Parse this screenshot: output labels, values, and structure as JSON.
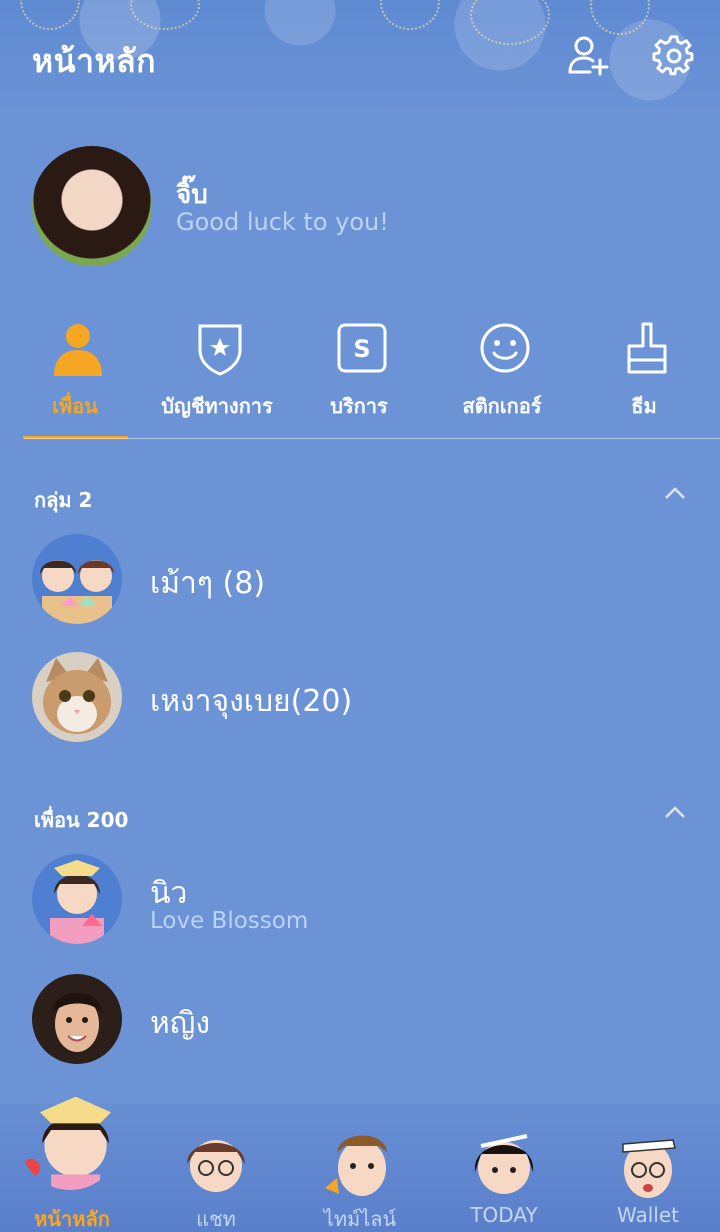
{
  "header": {
    "title": "หน้าหลัก",
    "add_friend_icon": "add-friend-icon",
    "settings_icon": "gear-icon"
  },
  "profile": {
    "name": "จิ๊บ",
    "status": "Good luck to you!"
  },
  "menu": {
    "items": [
      {
        "label": "เพื่อน",
        "icon": "person-icon",
        "active": true
      },
      {
        "label": "บัญชีทางการ",
        "icon": "shield-star-icon",
        "active": false
      },
      {
        "label": "บริการ",
        "icon": "service-s-icon",
        "active": false
      },
      {
        "label": "สติกเกอร์",
        "icon": "smiley-icon",
        "active": false
      },
      {
        "label": "ธีม",
        "icon": "brush-icon",
        "active": false
      }
    ]
  },
  "groups": {
    "header": "กลุ่ม 2",
    "items": [
      {
        "name": "เม้าๆ (8)"
      },
      {
        "name": "เหงาจุงเบย(20)"
      }
    ]
  },
  "friends": {
    "header": "เพื่อน 200",
    "items": [
      {
        "name": "นิว",
        "status": "Love Blossom"
      },
      {
        "name": "หญิง"
      }
    ]
  },
  "bottom_nav": {
    "items": [
      {
        "label": "หน้าหลัก",
        "active": true
      },
      {
        "label": "แชท",
        "active": false
      },
      {
        "label": "ไทม์ไลน์",
        "active": false
      },
      {
        "label": "TODAY",
        "active": false
      },
      {
        "label": "Wallet",
        "active": false
      }
    ]
  },
  "colors": {
    "background": "#6b93d6",
    "accent": "#f5a623",
    "subtext": "#bcd3f5"
  }
}
